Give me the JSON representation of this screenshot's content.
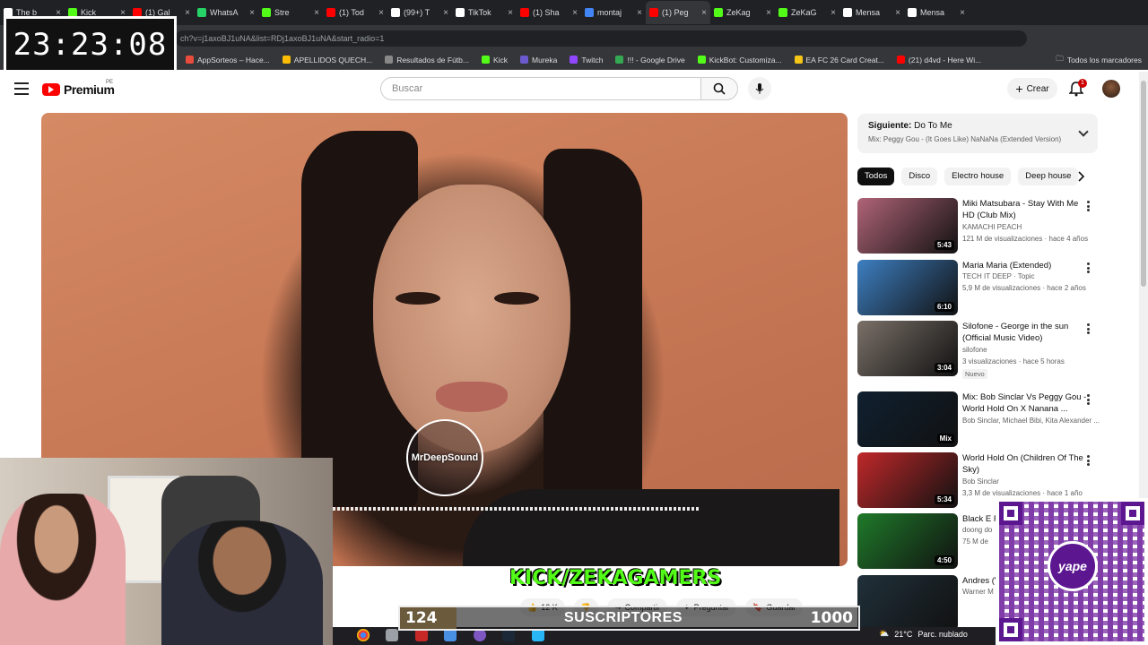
{
  "browser": {
    "tabs": [
      {
        "label": "The b",
        "color": "#ffffff"
      },
      {
        "label": "Kick",
        "color": "#53fc18"
      },
      {
        "label": "(1) Gal",
        "color": "#ff0000"
      },
      {
        "label": "WhatsA",
        "color": "#25d366"
      },
      {
        "label": "Stre",
        "color": "#53fc18"
      },
      {
        "label": "(1) Tod",
        "color": "#ff0000"
      },
      {
        "label": "(99+) T",
        "color": "#ffffff"
      },
      {
        "label": "TikTok",
        "color": "#ffffff"
      },
      {
        "label": "(1) Sha",
        "color": "#ff0000"
      },
      {
        "label": "montaj",
        "color": "#4285f4"
      },
      {
        "label": "(1) Peg",
        "color": "#ff0000"
      },
      {
        "label": "ZeKag",
        "color": "#53fc18"
      },
      {
        "label": "ZeKaG",
        "color": "#53fc18"
      },
      {
        "label": "Mensa",
        "color": "#ffffff"
      },
      {
        "label": "Mensa",
        "color": "#ffffff"
      }
    ],
    "url": "ch?v=j1axoBJ1uNA&list=RDj1axoBJ1uNA&start_radio=1",
    "bookmarks": [
      {
        "label": "AppSorteos – Hace...",
        "color": "#e74c3c"
      },
      {
        "label": "APELLIDOS QUECH...",
        "color": "#fbbc05"
      },
      {
        "label": "Resultados de Fútb...",
        "color": "#888888"
      },
      {
        "label": "Kick",
        "color": "#53fc18"
      },
      {
        "label": "Mureka",
        "color": "#6a5acd"
      },
      {
        "label": "Twitch",
        "color": "#9146ff"
      },
      {
        "label": "!!! - Google Drive",
        "color": "#34a853"
      },
      {
        "label": "KickBot: Customiza...",
        "color": "#53fc18"
      },
      {
        "label": "EA FC 26 Card Creat...",
        "color": "#f5c518"
      },
      {
        "label": "(21) d4vd - Here Wi...",
        "color": "#ff0000"
      }
    ],
    "all_bookmarks": "Todos los marcadores"
  },
  "clock": "23:23:08",
  "youtube": {
    "logo": "Premium",
    "region": "PE",
    "search_placeholder": "Buscar",
    "create_label": "Crear",
    "notifications": "1",
    "next": {
      "label": "Siguiente:",
      "title": "Do To Me",
      "mix": "Mix: Peggy Gou - (It Goes Like) NaNaNa (Extended Version)"
    },
    "chips": [
      "Todos",
      "Disco",
      "Electro house",
      "Deep house"
    ],
    "recommendations": [
      {
        "title": "Miki Matsubara - Stay With Me HD (Club Mix)",
        "channel": "KAMACHI PEACH",
        "meta": "121 M de visualizaciones · hace 4 años",
        "duration": "5:43",
        "thumb": "#b06478"
      },
      {
        "title": "Maria Maria (Extended)",
        "channel": "TECH IT DEEP · Topic",
        "meta": "5,9 M de visualizaciones · hace 2 años",
        "duration": "6:10",
        "thumb": "#3d7fc1"
      },
      {
        "title": "Silofone - George in the sun (Official Music Video)",
        "channel": "silofone",
        "meta": "3 visualizaciones · hace 5 horas",
        "duration": "3:04",
        "thumb": "#7a7068",
        "badge": "Nuevo"
      },
      {
        "title": "Mix: Bob Sinclar Vs Peggy Gou - World Hold On X Nanana ...",
        "channel": "Bob Sinclar, Michael Bibi, Kita Alexander ...",
        "meta": "",
        "duration": "Mix",
        "thumb": "#102030"
      },
      {
        "title": "World Hold On (Children Of The Sky)",
        "channel": "Bob Sinclar",
        "meta": "3,3 M de visualizaciones · hace 1 año",
        "duration": "5:34",
        "thumb": "#c0282a"
      },
      {
        "title": "Black E Feeling",
        "channel": "doong do",
        "meta": "75 M de",
        "duration": "4:50",
        "thumb": "#1f7a2a"
      },
      {
        "title": "Andres (Videoc",
        "channel": "Warner M",
        "meta": "",
        "duration": "",
        "thumb": "#20303a"
      }
    ],
    "actions": {
      "likes": "12 K",
      "share": "Compartir",
      "ask": "Preguntar",
      "save": "Guardar"
    }
  },
  "overlay": {
    "video_logo": "MrDeepSound",
    "kick_prefix": "KICK/",
    "kick_channel": "ZEKAGAMERS",
    "subs_current": "124",
    "subs_label": "SUSCRIPTORES",
    "subs_goal": "1000",
    "subs_progress": 0.124,
    "yape_label": "yape"
  },
  "taskbar": {
    "weather_temp": "21°C",
    "weather_text": "Parc. nublado"
  }
}
